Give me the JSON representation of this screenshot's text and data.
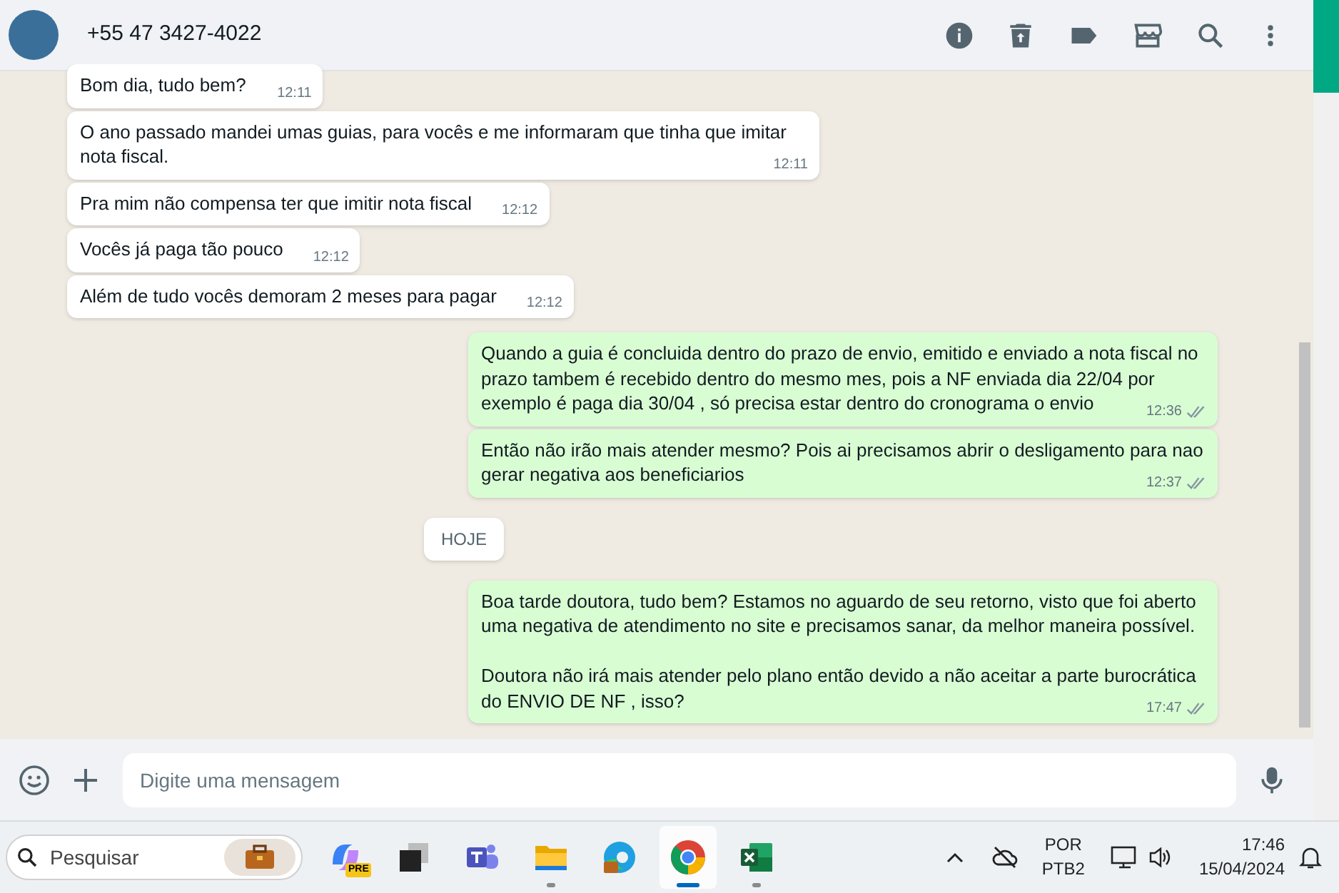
{
  "chat_header": {
    "contact": "+55 47 3427-4022"
  },
  "messages": [
    {
      "kind": "in",
      "text": "Bom dia, tudo bem?",
      "time": "12:11"
    },
    {
      "kind": "in",
      "text": "O ano passado mandei umas guias, para vocês e me informaram que tinha que imitar nota fiscal.",
      "time": "12:11"
    },
    {
      "kind": "in",
      "text": "Pra mim não compensa ter que imitir nota fiscal",
      "time": "12:12"
    },
    {
      "kind": "in",
      "text": "Vocês já paga tão pouco",
      "time": "12:12"
    },
    {
      "kind": "in",
      "text": "Além de tudo vocês demoram 2 meses para pagar",
      "time": "12:12"
    },
    {
      "kind": "out",
      "text": "Quando a guia é concluida dentro do prazo de envio, emitido e enviado a nota fiscal no prazo tambem é recebido dentro do mesmo mes, pois a NF enviada dia 22/04 por exemplo é paga dia 30/04 , só precisa estar dentro do cronograma o envio",
      "time": "12:36",
      "read": false
    },
    {
      "kind": "out",
      "text": "Então não irão mais atender mesmo? Pois ai precisamos abrir o desligamento para nao gerar negativa aos beneficiarios",
      "time": "12:37",
      "read": false
    },
    {
      "kind": "date",
      "text": "HOJE"
    },
    {
      "kind": "out",
      "text": "Boa tarde doutora, tudo bem? Estamos no aguardo de seu retorno, visto que foi aberto uma negativa de atendimento no site e precisamos sanar, da melhor maneira possível.\n\nDoutora não irá mais atender pelo plano então devido a não aceitar a parte burocrática do ENVIO DE NF , isso?",
      "time": "17:47",
      "read": false
    }
  ],
  "composer": {
    "placeholder": "Digite uma mensagem"
  },
  "taskbar": {
    "search": {
      "placeholder": "Pesquisar"
    },
    "apps": [
      {
        "kind": "copilot",
        "badge": "PRE",
        "open": false,
        "active": false
      },
      {
        "kind": "taskview",
        "open": false,
        "active": false
      },
      {
        "kind": "teams",
        "open": false,
        "active": false
      },
      {
        "kind": "explorer",
        "open": true,
        "active": false
      },
      {
        "kind": "edge",
        "open": false,
        "active": false
      },
      {
        "kind": "chrome",
        "open": true,
        "active": true
      },
      {
        "kind": "excel",
        "open": true,
        "active": false
      }
    ],
    "language": {
      "line1": "POR",
      "line2": "PTB2"
    },
    "clock": {
      "time": "17:46",
      "date": "15/04/2024"
    }
  }
}
